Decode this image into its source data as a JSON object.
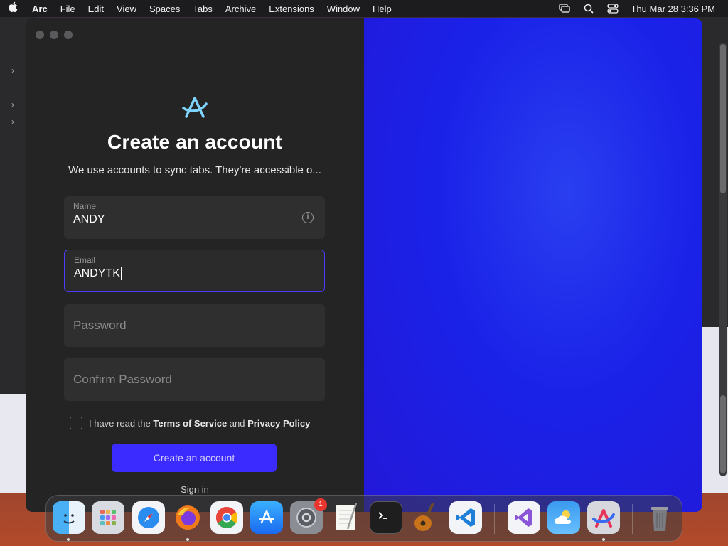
{
  "menubar": {
    "app": "Arc",
    "items": [
      "File",
      "Edit",
      "View",
      "Spaces",
      "Tabs",
      "Archive",
      "Extensions",
      "Window",
      "Help"
    ],
    "clock": "Thu Mar 28  3:36 PM"
  },
  "form": {
    "title": "Create an account",
    "subtitle": "We use accounts to sync tabs. They're accessible o...",
    "name_label": "Name",
    "name_value": "ANDY",
    "email_label": "Email",
    "email_value": "ANDYTK",
    "password_placeholder": "Password",
    "confirm_placeholder": "Confirm Password",
    "agree_prefix": "I have read the",
    "terms": "Terms of Service",
    "agree_and": "and",
    "privacy": "Privacy Policy",
    "create_button": "Create an account",
    "signin": "Sign in"
  },
  "dock": {
    "apps": [
      "Finder",
      "Launchpad",
      "Safari",
      "Firefox",
      "Chrome",
      "App Store",
      "System Settings",
      "TextEdit",
      "Terminal",
      "GarageBand",
      "VS Code",
      "Visual Studio",
      "Weather",
      "Arc",
      "Trash"
    ],
    "settings_badge": "1"
  },
  "colors": {
    "accent": "#3b2bff",
    "right_pane": "#1a22e8",
    "window_bg": "#242424"
  }
}
